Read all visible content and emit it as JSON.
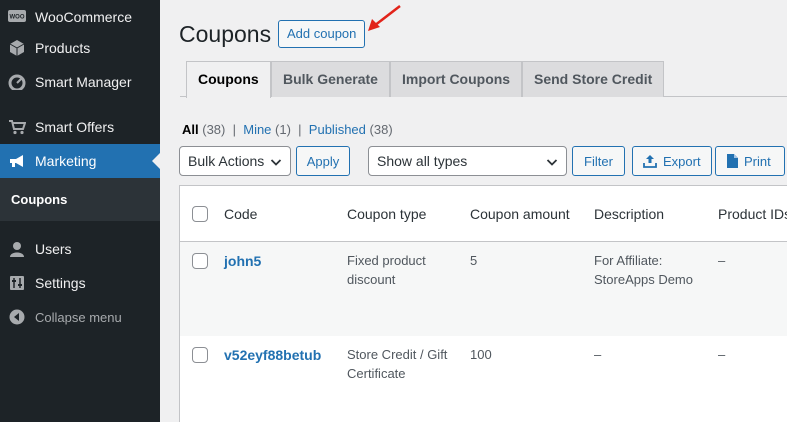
{
  "sidebar": {
    "items": [
      {
        "label": "WooCommerce",
        "icon": "woo-icon"
      },
      {
        "label": "Products",
        "icon": "cube-icon"
      },
      {
        "label": "Smart Manager",
        "icon": "dashboard-icon"
      },
      {
        "label": "Smart Offers",
        "icon": "cart-icon"
      },
      {
        "label": "Marketing",
        "icon": "megaphone-icon"
      },
      {
        "label": "Users",
        "icon": "user-icon"
      },
      {
        "label": "Settings",
        "icon": "settings-icon"
      }
    ],
    "submenu_active": "Coupons",
    "collapse": "Collapse menu",
    "woo_badge": "WOO"
  },
  "header": {
    "title": "Coupons",
    "add_button": "Add coupon"
  },
  "tabs": [
    "Coupons",
    "Bulk Generate",
    "Import Coupons",
    "Send Store Credit"
  ],
  "filters": {
    "all": "All",
    "all_count": "(38)",
    "mine": "Mine",
    "mine_count": "(1)",
    "published": "Published",
    "published_count": "(38)",
    "sep": "|"
  },
  "toolbar": {
    "bulk_actions": "Bulk Actions",
    "apply": "Apply",
    "type_select": "Show all types",
    "filter": "Filter",
    "export": "Export",
    "print": "Print"
  },
  "table": {
    "columns": [
      "Code",
      "Coupon type",
      "Coupon amount",
      "Description",
      "Product IDs"
    ],
    "rows": [
      {
        "code": "john5",
        "type_line1": "Fixed product",
        "type_line2": "discount",
        "amount": "5",
        "desc_line1": "For Affiliate:",
        "desc_line2": "StoreApps Demo",
        "product_ids": "–"
      },
      {
        "code": "v52eyf88betub",
        "type_line1": "Store Credit / Gift",
        "type_line2": "Certificate",
        "amount": "100",
        "desc_line1": "–",
        "desc_line2": "",
        "product_ids": "–"
      }
    ]
  },
  "colors": {
    "sidebar_bg": "#1d2327",
    "accent": "#2271b1",
    "arrow": "#e2231a"
  }
}
